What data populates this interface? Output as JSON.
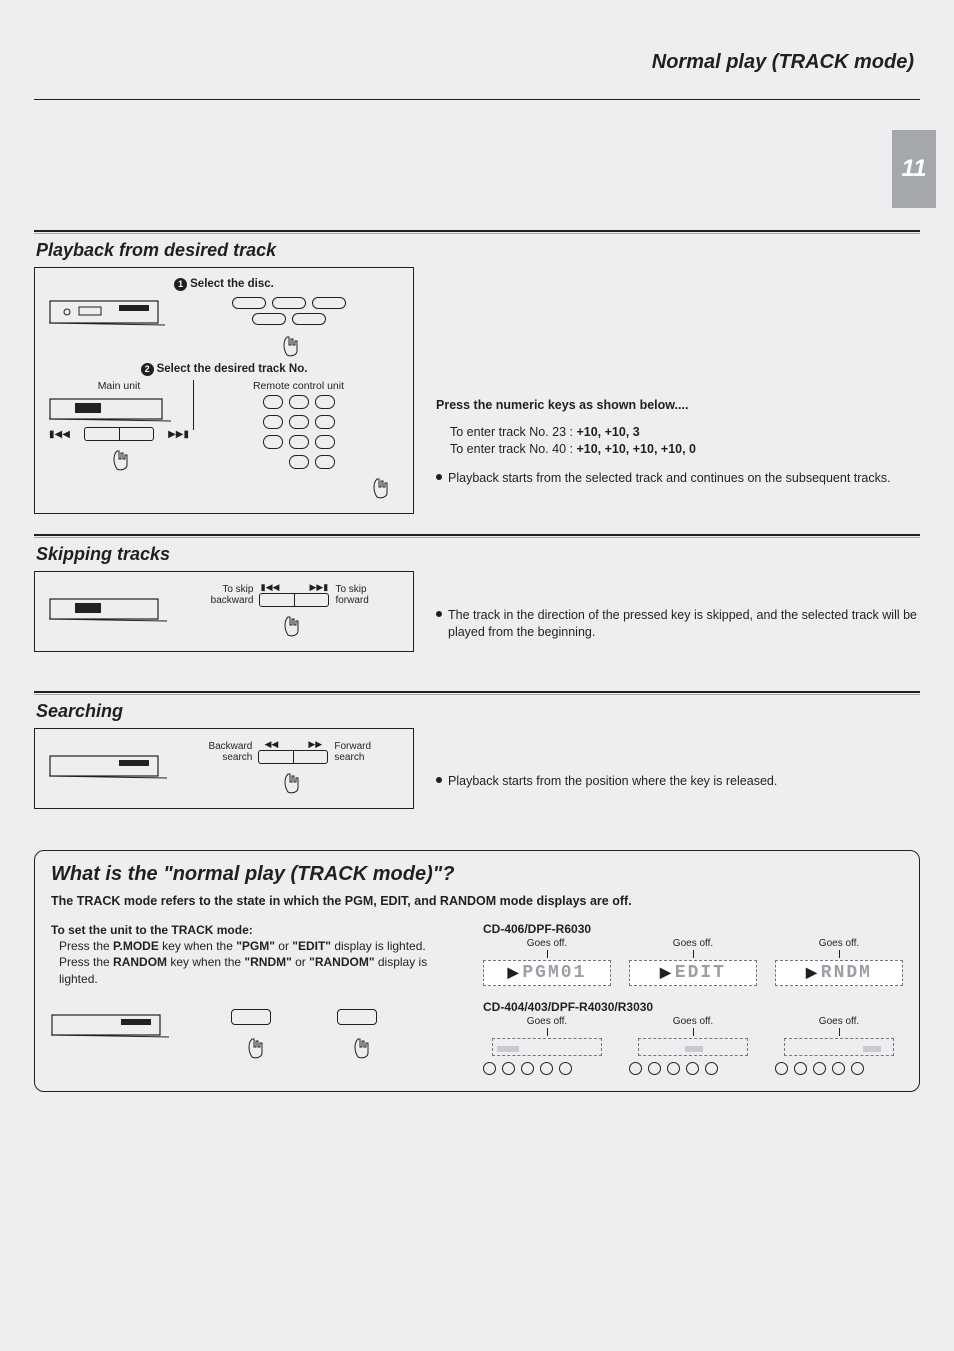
{
  "header": {
    "title": "Normal play  (TRACK mode)",
    "page_number": "11"
  },
  "section_playback": {
    "title": "Playback from desired track",
    "step1": "Select the disc.",
    "step2": "Select the desired track  No.",
    "main_unit_label": "Main unit",
    "remote_label": "Remote control unit",
    "right_heading": "Press the numeric keys as shown below....",
    "ex1_prefix": "To enter track No. 23 : ",
    "ex1_keys": "+10, +10, 3",
    "ex2_prefix": "To enter track No. 40 : ",
    "ex2_keys": "+10, +10, +10, +10, 0",
    "note": "Playback starts from the selected track and continues on the subsequent tracks."
  },
  "section_skipping": {
    "title": "Skipping tracks",
    "skip_back": "To skip backward",
    "skip_fwd": "To skip forward",
    "note": "The track in the direction of the pressed key is skipped, and the selected track will be played from  the beginning."
  },
  "section_searching": {
    "title": "Searching",
    "back_label": "Backward search",
    "fwd_label": "Forward search",
    "note": "Playback starts from the position where the key is released."
  },
  "info": {
    "title": "What is the \"normal play (TRACK mode)\"?",
    "sub": "The TRACK mode refers to the state in which the PGM, EDIT, and RANDOM mode displays are off.",
    "set_heading": "To set the unit to the TRACK mode:",
    "set_body_1a": "Press the ",
    "set_body_1b": "P.MODE",
    "set_body_1c": " key when the ",
    "set_body_1d": "\"PGM\"",
    "set_body_1e": " or ",
    "set_body_1f": "\"EDIT\"",
    "set_body_1g": " display is lighted.",
    "set_body_2a": "Press the ",
    "set_body_2b": "RANDOM",
    "set_body_2c": " key when the ",
    "set_body_2d": "\"RNDM\"",
    "set_body_2e": " or ",
    "set_body_2f": "\"RANDOM\"",
    "set_body_2g": " display is lighted.",
    "model_a": "CD-406/DPF-R6030",
    "model_b": "CD-404/403/DPF-R4030/R3030",
    "goes_off": "Goes off.",
    "disp_pgm": "PGM01",
    "disp_edit": "EDIT",
    "disp_rndm": "RNDM"
  }
}
